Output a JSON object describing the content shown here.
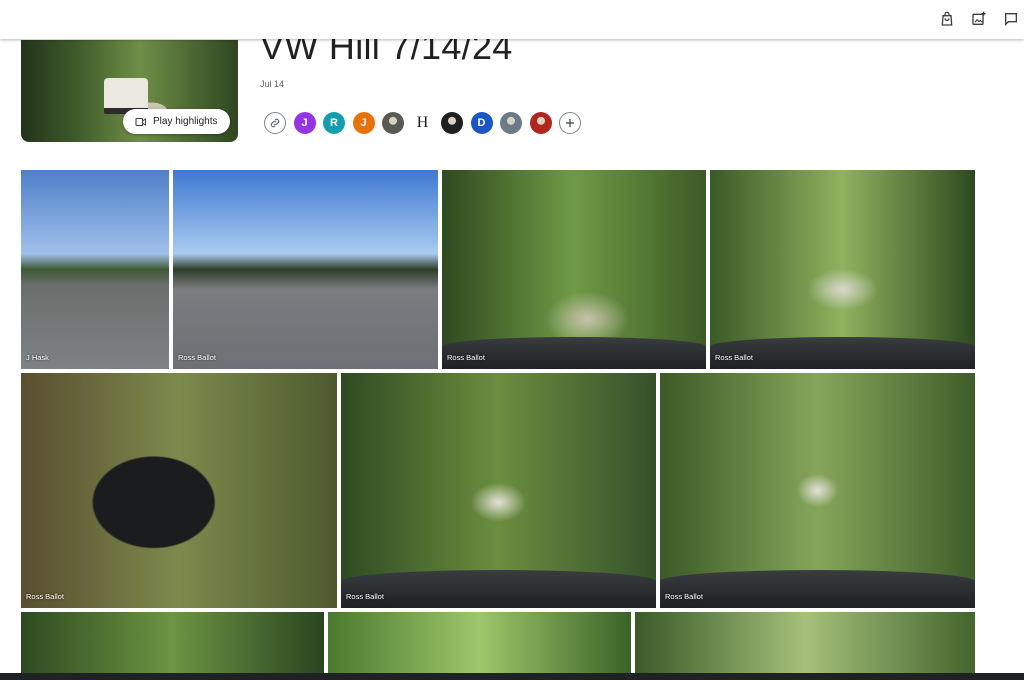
{
  "album": {
    "title": "VW Hill 7/14/24",
    "date": "Jul 14",
    "play_highlights": "Play highlights"
  },
  "topbar": {
    "icons": [
      "shopping-bag-icon",
      "add-photo-icon",
      "comment-icon"
    ]
  },
  "people": [
    {
      "type": "link-icon"
    },
    {
      "letter": "J",
      "color": "#9334e6"
    },
    {
      "letter": "R",
      "color": "#129eaf"
    },
    {
      "letter": "J",
      "color": "#e8710a"
    },
    {
      "type": "photo-avatar",
      "color": "#5a5a52"
    },
    {
      "letter": "H",
      "plain": true
    },
    {
      "type": "photo-avatar",
      "color": "#1f1f1f"
    },
    {
      "letter": "D",
      "color": "#1a56c4"
    },
    {
      "type": "photo-avatar",
      "color": "#6c7a88"
    },
    {
      "type": "photo-avatar",
      "color": "#b3261e"
    },
    {
      "type": "add-icon"
    }
  ],
  "photos": [
    {
      "label": "J Hask"
    },
    {
      "label": "Ross Ballot"
    },
    {
      "label": "Ross Ballot"
    },
    {
      "label": "Ross Ballot"
    },
    {
      "label": "Ross Ballot"
    },
    {
      "label": "Ross Ballot"
    },
    {
      "label": "Ross Ballot"
    },
    {
      "label": ""
    },
    {
      "label": ""
    },
    {
      "label": ""
    }
  ],
  "colors": {
    "accent": "#1a73e8",
    "text": "#202124",
    "secondary_text": "#5f6368"
  }
}
